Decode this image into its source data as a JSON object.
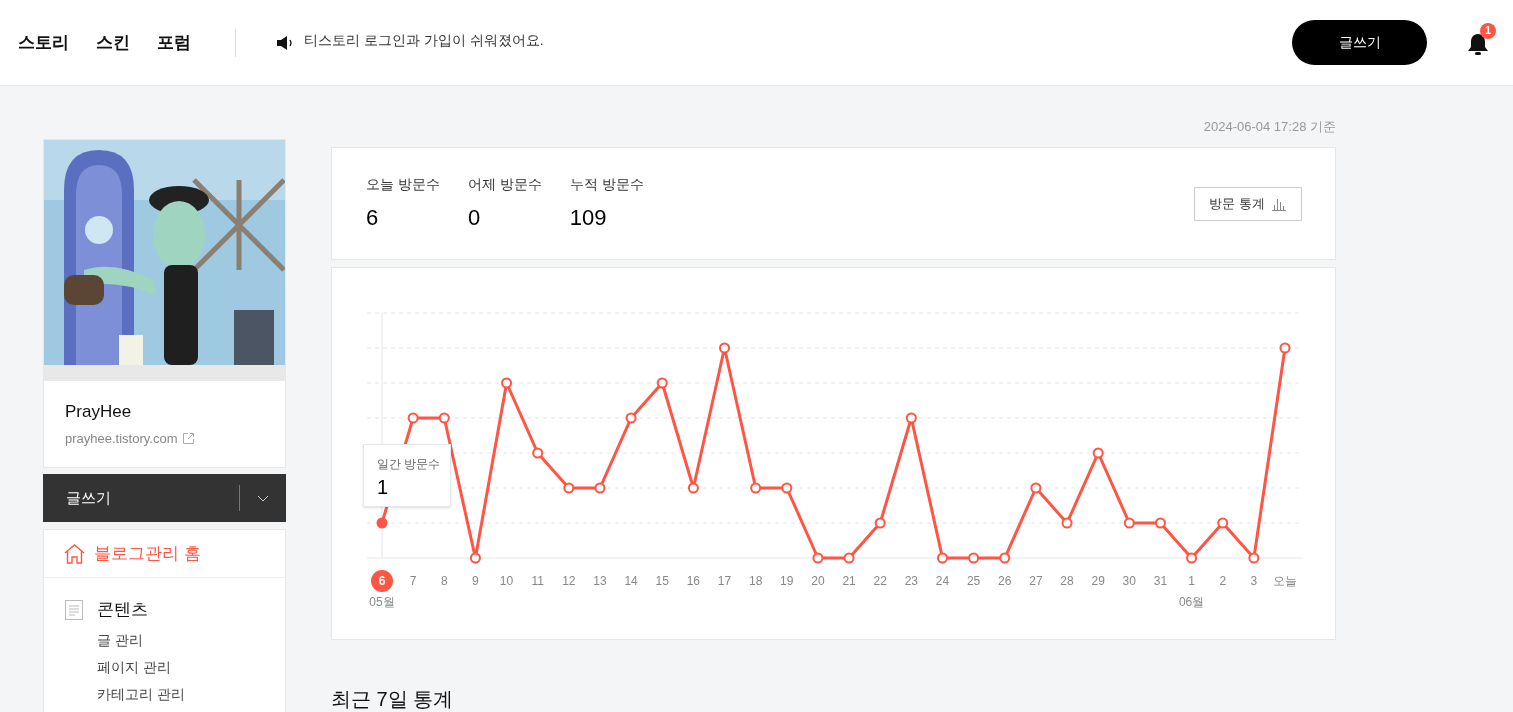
{
  "header": {
    "nav": [
      "스토리",
      "스킨",
      "포럼"
    ],
    "notice": "티스토리 로그인과 가입이 쉬워졌어요.",
    "write_button": "글쓰기",
    "notification_count": "1"
  },
  "sidebar": {
    "profile": {
      "kind": "picture",
      "name": "PrayHee",
      "url": "prayhee.tistory.com"
    },
    "write_button": "글쓰기",
    "home": {
      "label": "블로그관리 홈",
      "selected": true
    },
    "sections": [
      {
        "title": "콘텐츠",
        "items": [
          "글 관리",
          "페이지 관리",
          "카테고리 관리"
        ]
      }
    ]
  },
  "timestamp": "2024-06-04 17:28 기준",
  "stats": [
    {
      "label": "오늘 방문수",
      "value": "6"
    },
    {
      "label": "어제 방문수",
      "value": "0"
    },
    {
      "label": "누적 방문수",
      "value": "109"
    }
  ],
  "stats_button": "방문 통계",
  "chart": {
    "axis": [
      {
        "day": "6",
        "month": "05월",
        "selected": true
      },
      {
        "day": "7",
        "selected": false
      },
      {
        "day": "8",
        "selected": false
      },
      {
        "day": "9",
        "selected": false
      },
      {
        "day": "10",
        "selected": false
      },
      {
        "day": "11",
        "selected": false
      },
      {
        "day": "12",
        "selected": false
      },
      {
        "day": "13",
        "selected": false
      },
      {
        "day": "14",
        "selected": false
      },
      {
        "day": "15",
        "selected": false
      },
      {
        "day": "16",
        "selected": false
      },
      {
        "day": "17",
        "selected": false
      },
      {
        "day": "18",
        "selected": false
      },
      {
        "day": "19",
        "selected": false
      },
      {
        "day": "20",
        "selected": false
      },
      {
        "day": "21",
        "selected": false
      },
      {
        "day": "22",
        "selected": false
      },
      {
        "day": "23",
        "selected": false
      },
      {
        "day": "24",
        "selected": false
      },
      {
        "day": "25",
        "selected": false
      },
      {
        "day": "26",
        "selected": false
      },
      {
        "day": "27",
        "selected": false
      },
      {
        "day": "28",
        "selected": false
      },
      {
        "day": "29",
        "selected": false
      },
      {
        "day": "30",
        "selected": false
      },
      {
        "day": "31",
        "selected": false
      },
      {
        "day": "1",
        "month": "06월",
        "selected": false
      },
      {
        "day": "2",
        "selected": false
      },
      {
        "day": "3",
        "selected": false
      },
      {
        "day": "오늘",
        "selected": false
      }
    ],
    "tooltip": {
      "label": "일간 방문수",
      "value": "1"
    }
  },
  "recent_title": "최근 7일 통계"
}
